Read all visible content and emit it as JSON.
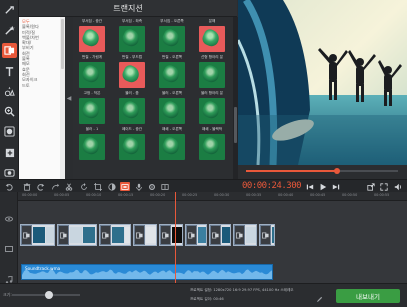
{
  "app": {
    "panel_title": "트랜지션"
  },
  "colors": {
    "accent": "#e8583a",
    "export_green": "#3a9d43",
    "audio_blue": "#2a8ad6"
  },
  "sidebar_tools": [
    {
      "name": "import-icon",
      "active": false
    },
    {
      "name": "wand-icon",
      "active": false
    },
    {
      "name": "transitions-icon",
      "active": true
    },
    {
      "name": "text-icon",
      "active": false
    },
    {
      "name": "shapes-icon",
      "active": false
    },
    {
      "name": "zoom-icon",
      "active": false
    },
    {
      "name": "filters-icon",
      "active": false
    },
    {
      "name": "add-media-icon",
      "active": false
    },
    {
      "name": "record-icon",
      "active": false
    }
  ],
  "categories": [
    "모두",
    "블록/원다",
    "미적/질",
    "백불/차번",
    "확대/",
    "부비기",
    "회전",
    "",
    "불록",
    "메모",
    "효문",
    "회전",
    "모자이크",
    "드토"
  ],
  "transitions": [
    {
      "label": "부서짐 - 중간",
      "red": false
    },
    {
      "label": "부서짐 - 좌측",
      "red": false
    },
    {
      "label": "부서짐 - 오른쪽",
      "red": false
    },
    {
      "label": "분해",
      "red": false
    },
    {
      "label": "",
      "red": true
    },
    {
      "label": "",
      "red": false
    },
    {
      "label": "",
      "red": false
    },
    {
      "label": "",
      "red": true
    },
    {
      "label": "번질 - 가림게",
      "red": false
    },
    {
      "label": "번질 - 부드럽",
      "red": false
    },
    {
      "label": "번질 - 오른쪽",
      "red": false
    },
    {
      "label": "선형 항아리 분",
      "red": false
    },
    {
      "label": "",
      "red": false
    },
    {
      "label": "",
      "red": true
    },
    {
      "label": "",
      "red": false
    },
    {
      "label": "",
      "red": false
    },
    {
      "label": "고정 - 작은",
      "red": false
    },
    {
      "label": "블러 - 줌",
      "red": false
    },
    {
      "label": "블러 - 오른쪽",
      "red": false
    },
    {
      "label": "블러 항아리 분",
      "red": false
    },
    {
      "label": "",
      "red": false
    },
    {
      "label": "",
      "red": false
    },
    {
      "label": "",
      "red": false
    },
    {
      "label": "",
      "red": false
    },
    {
      "label": "블러 - 1",
      "red": false
    },
    {
      "label": "페이드 - 중간",
      "red": false
    },
    {
      "label": "패쇄 - 오른쪽",
      "red": false
    },
    {
      "label": "패쇄 - 블랙박",
      "red": false
    },
    {
      "label": "",
      "red": false
    },
    {
      "label": "",
      "red": false
    },
    {
      "label": "",
      "red": false
    },
    {
      "label": "",
      "red": false
    }
  ],
  "player": {
    "timecode_main": "00:00:",
    "timecode_frac": "24.300",
    "progress": 0.6
  },
  "ruler_ticks": [
    "00:00:00",
    "00:00:05",
    "00:00:10",
    "00:00:15",
    "00:00:20",
    "00:00:25",
    "00:00:30",
    "00:00:35",
    "00:00:40",
    "00:00:45",
    "00:00:50",
    "00:00:55"
  ],
  "audio_track": {
    "label": "Soundtrack.wma"
  },
  "bottom": {
    "zoom_label": "크기:",
    "zoom": 0.55,
    "project_settings": "프로젝트 설정:   1280x720 16:9 29.97 FPS, 44100 Hz 스테레오",
    "project_length": "프로젝트 길이:   00:46",
    "export_label": "내보내기"
  }
}
